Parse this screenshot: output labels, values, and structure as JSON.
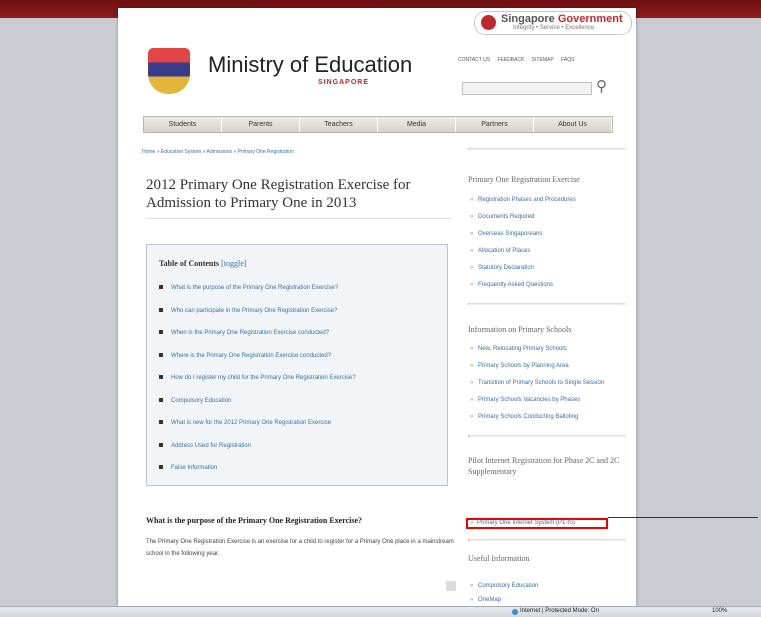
{
  "gov": {
    "line1a": "Singapore ",
    "line1b": "Government",
    "tagline": "Integrity • Service • Excellence"
  },
  "header": {
    "title": "Ministry of Education",
    "subtitle": "SINGAPORE"
  },
  "util_links": [
    "CONTACT US",
    "FEEDBACK",
    "SITEMAP",
    "FAQS"
  ],
  "nav": [
    "Students",
    "Parents",
    "Teachers",
    "Media",
    "Partners",
    "About Us"
  ],
  "breadcrumb": "Home » Education System » Admissions » Primary One Registration",
  "page_title": "2012 Primary One Registration Exercise for Admission to Primary One in 2013",
  "toc": {
    "title": "Table of Contents",
    "toggle": "[toggle]",
    "items": [
      "What is the purpose of the Primary One Registration Exercise?",
      "Who can participate in the Primary One Registration Exercise?",
      "When is the Primary One Registration Exercise conducted?",
      "Where is the Primary One Registration Exercise conducted?",
      "How do I register my child for the Primary One Registration Exercise?",
      "Compulsory Education",
      "What is new for the 2012 Primary One Registration Exercise",
      "Address Used for Registration",
      "False Information"
    ]
  },
  "section": {
    "heading": "What is the purpose of the Primary One Registration Exercise?",
    "body": "The Primary One Registration Exercise is an exercise for a child to register for a Primary One place in a mainstream school in the following year."
  },
  "sidebar": {
    "g1": {
      "title": "Primary One Registration Exercise",
      "items": [
        "Registration Phases and Procedures",
        "Documents Required",
        "Overseas Singaporeans",
        "Allocation of Places",
        "Statutory Declaration",
        "Frequently Asked Questions"
      ]
    },
    "g2": {
      "title": "Information on Primary Schools",
      "items": [
        "New, Relocating Primary Schools",
        "Primary Schools by Planning Area",
        "Transition of Primary Schools to Single Session",
        "Primary Schools Vacancies by Phases",
        "Primary Schools Conducting Balloting"
      ]
    },
    "g3": {
      "title": "Pilot Internet Registration for Phase 2C and 2C Supplementary",
      "highlight": "Primary One Internet System (P1-IS)"
    },
    "g4": {
      "title": "Useful Information",
      "items": [
        "Compulsory Education",
        "OneMap"
      ]
    }
  },
  "status": {
    "text": "Internet | Protected Mode: On",
    "zoom": "100%"
  }
}
